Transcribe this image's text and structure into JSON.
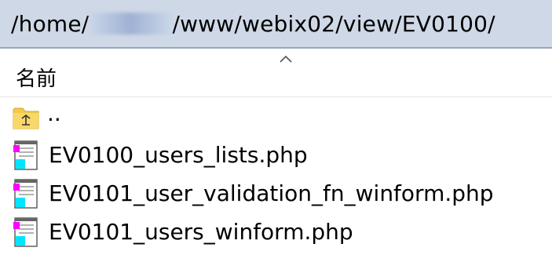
{
  "path_bar": {
    "prefix": "/home/",
    "redacted_segment": "",
    "suffix": "/www/webix02/view/EV0100/"
  },
  "list_header": {
    "name_column": "名前",
    "sort_direction": "ascending"
  },
  "entries": [
    {
      "name": "..",
      "type": "parent-folder",
      "icon": "folder-up-icon"
    },
    {
      "name": "EV0100_users_lists.php",
      "type": "file",
      "icon": "php-file-icon"
    },
    {
      "name": "EV0101_user_validation_fn_winform.php",
      "type": "file",
      "icon": "php-file-icon"
    },
    {
      "name": "EV0101_users_winform.php",
      "type": "file",
      "icon": "php-file-icon"
    }
  ],
  "colors": {
    "path_bar_background": "#cfd8e6",
    "folder_yellow": "#f2c94c",
    "file_icon_magenta": "#ff00ff",
    "file_icon_cyan": "#00e5ff"
  }
}
